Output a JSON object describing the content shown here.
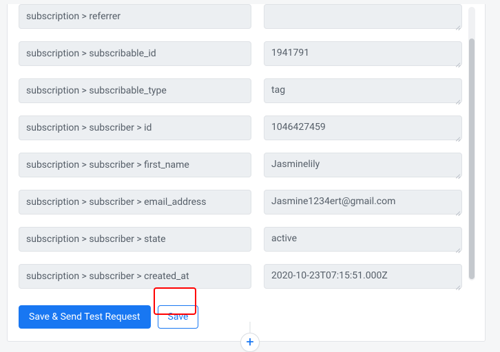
{
  "fields": [
    {
      "key": "subscription > referrer",
      "value": ""
    },
    {
      "key": "subscription > subscribable_id",
      "value": "1941791"
    },
    {
      "key": "subscription > subscribable_type",
      "value": "tag"
    },
    {
      "key": "subscription > subscriber > id",
      "value": "1046427459"
    },
    {
      "key": "subscription > subscriber > first_name",
      "value": "Jasminelily"
    },
    {
      "key": "subscription > subscriber > email_address",
      "value": "Jasmine1234ert@gmail.com"
    },
    {
      "key": "subscription > subscriber > state",
      "value": "active"
    },
    {
      "key": "subscription > subscriber > created_at",
      "value": "2020-10-23T07:15:51.000Z"
    }
  ],
  "buttons": {
    "primary": "Save & Send Test Request",
    "secondary": "Save"
  },
  "addIcon": "+"
}
